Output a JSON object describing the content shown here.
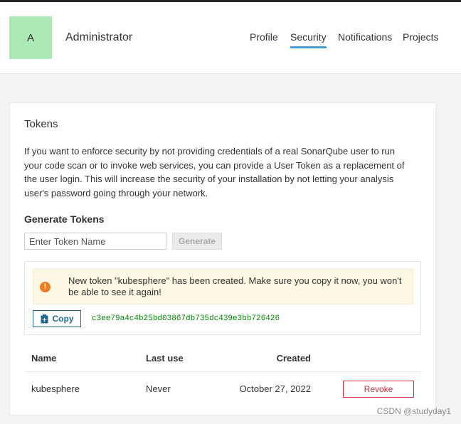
{
  "header": {
    "avatar_letter": "A",
    "user_name": "Administrator",
    "nav": {
      "profile": "Profile",
      "security": "Security",
      "notifications": "Notifications",
      "projects": "Projects"
    },
    "active_tab": "Security",
    "active_tab_color": "#4b9fd5"
  },
  "tokens": {
    "title": "Tokens",
    "description": "If you want to enforce security by not providing credentials of a real SonarQube user to run your code scan or to invoke web services, you can provide a User Token as a replacement of the user login. This will increase the security of your installation by not letting your analysis user's password going through your network.",
    "generate_title": "Generate Tokens",
    "input_placeholder": "Enter Token Name",
    "input_value": "",
    "generate_label": "Generate",
    "alert": {
      "icon": "warning-icon",
      "text": "New token \"kubesphere\" has been created. Make sure you copy it now, you won't be able to see it again!"
    },
    "copy_label": "Copy",
    "copy_icon": "clipboard-icon",
    "token_value": "c3ee79a4c4b25bd03867db735dc439e3bb726426",
    "table": {
      "columns": [
        "Name",
        "Last use",
        "Created"
      ],
      "rows": [
        {
          "name": "kubesphere",
          "last_use": "Never",
          "created": "October 27, 2022",
          "action": "Revoke"
        }
      ]
    }
  },
  "watermark": "CSDN @studyday1",
  "colors": {
    "avatar_bg": "#aae8b5",
    "token_green": "#008a00",
    "revoke_red": "#d02f3a",
    "copy_blue": "#236a97",
    "alert_bg": "#fcf8e3",
    "alert_icon": "#ed7d20"
  }
}
